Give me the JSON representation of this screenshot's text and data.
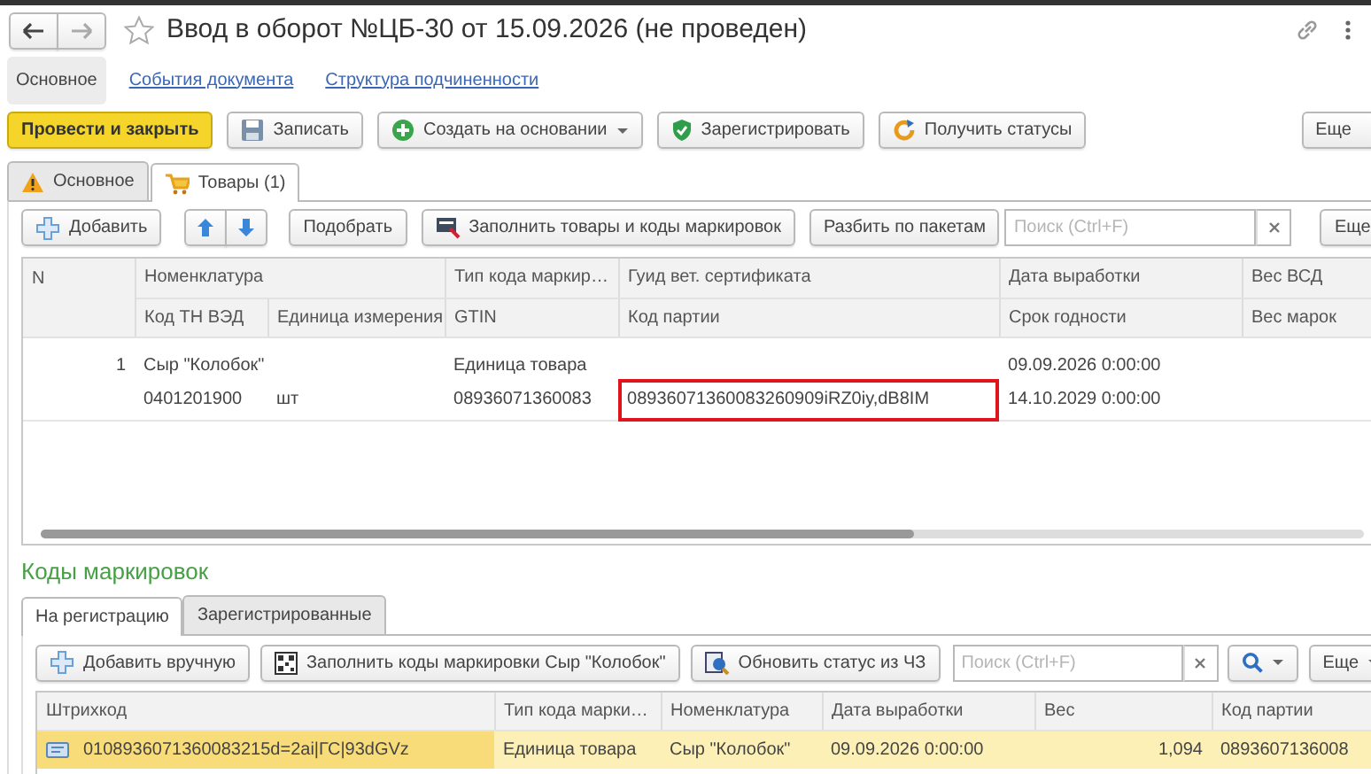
{
  "window": {
    "title": "Ввод в оборот №ЦБ-30 от 15.09.2026 (не проведен)",
    "starred": false
  },
  "nav_links": [
    {
      "label": "Основное",
      "selected": true
    },
    {
      "label": "События документа",
      "selected": false
    },
    {
      "label": "Структура подчиненности",
      "selected": false
    }
  ],
  "commands": [
    {
      "label": "Провести и закрыть",
      "primary": true,
      "dropdown": false
    },
    {
      "label": "Записать",
      "primary": false,
      "dropdown": false
    },
    {
      "label": "Создать на основании",
      "primary": false,
      "dropdown": true
    },
    {
      "label": "Зарегистрировать",
      "primary": false,
      "dropdown": false
    },
    {
      "label": "Получить статусы",
      "primary": false,
      "dropdown": false
    }
  ],
  "more_button": "Еще",
  "tabs": [
    {
      "label": "Основное",
      "selected": false,
      "warning": true
    },
    {
      "label": "Товары (1)",
      "selected": true,
      "warning": false
    }
  ],
  "goods_toolbar": {
    "add": "Добавить",
    "pick": "Подобрать",
    "fill": "Заполнить товары и коды маркировок",
    "split": "Разбить по пакетам",
    "search_placeholder": "Поиск (Ctrl+F)",
    "more": "Еще"
  },
  "goods_table": {
    "columns": [
      {
        "label": "N"
      },
      {
        "label": "Номенклатура",
        "sub": [
          "Код ТН ВЭД",
          "Единица измерения"
        ]
      },
      {
        "label": "Тип кода маркир…",
        "sub": [
          "GTIN"
        ]
      },
      {
        "label": "Гуид вет. сертификата",
        "sub": [
          "Код партии"
        ]
      },
      {
        "label": "Дата выработки",
        "sub": [
          "Срок годности"
        ]
      },
      {
        "label": "Вес ВСД",
        "sub": [
          "Вес марок"
        ]
      }
    ],
    "rows": [
      {
        "n": "1",
        "nomenclature": "Сыр \"Колобок\"",
        "tn_ved": "0401201900",
        "unit": "шт",
        "marking_type": "Единица товара",
        "gtin": "08936071360083",
        "batch_code": "08936071360083260909iRZ0iy,dB8IM",
        "batch_code_highlighted": true,
        "production_date": "09.09.2026 0:00:00",
        "expiry_date": "14.10.2029 0:00:00"
      }
    ]
  },
  "marking_codes": {
    "title": "Коды маркировок",
    "tabs": [
      {
        "label": "На регистрацию",
        "selected": true
      },
      {
        "label": "Зарегистрированные",
        "selected": false
      }
    ],
    "toolbar": {
      "add": "Добавить вручную",
      "fill": "Заполнить коды маркировки Сыр \"Колобок\"",
      "refresh": "Обновить статус из ЧЗ",
      "search_placeholder": "Поиск (Ctrl+F)",
      "more": "Еще"
    },
    "columns": [
      "Штрихкод",
      "Тип кода марки…",
      "Номенклатура",
      "Дата выработки",
      "Вес",
      "Код партии"
    ],
    "rows": [
      {
        "selected": true,
        "cells": [
          "0108936071360083215d=2ai|ГС|93dGVz",
          "Единица товара",
          "Сыр \"Колобок\"",
          "09.09.2026 0:00:00",
          "1,094",
          "0893607136008"
        ]
      }
    ]
  }
}
